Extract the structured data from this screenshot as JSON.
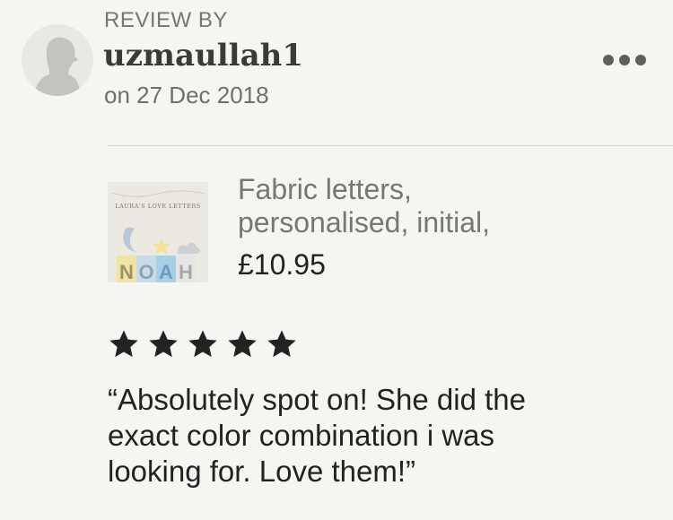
{
  "review": {
    "label": "REVIEW BY",
    "username": "uzmaullah1",
    "date": "on 27 Dec 2018",
    "rating": 5,
    "rating_max": 5,
    "text_lines": [
      "“Absolutely spot on! She did the",
      "exact color combination i was",
      "looking for. Love them!”"
    ]
  },
  "listing": {
    "title_lines": [
      "Fabric letters,",
      "personalised, initial,"
    ],
    "price": "£10.95",
    "thumbnail": {
      "caption": "LAURA'S LOVE LETTERS",
      "letters": [
        "N",
        "O",
        "A",
        "H"
      ]
    }
  },
  "icons": {
    "avatar": "default-user-silhouette-icon",
    "more": "ellipsis-icon",
    "star": "star-filled-icon"
  },
  "colors": {
    "background": "#f5f5f1",
    "star": "#222222",
    "muted_text": "#767676"
  }
}
